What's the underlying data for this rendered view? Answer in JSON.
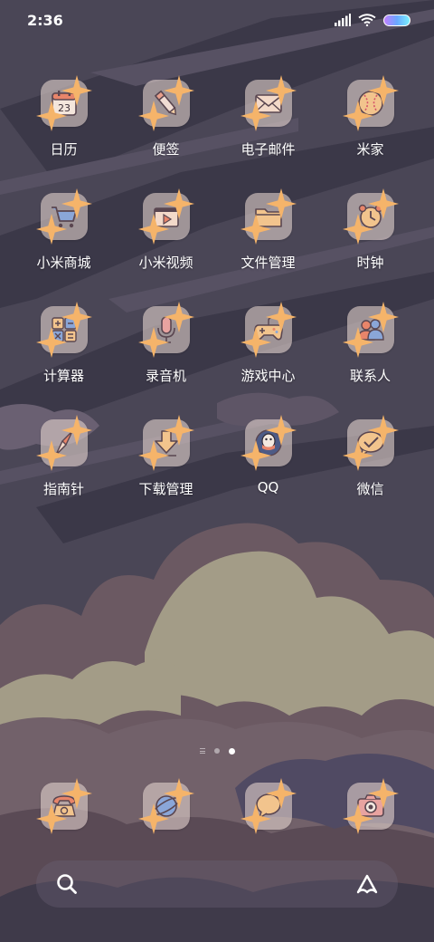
{
  "status_bar": {
    "time": "2:36"
  },
  "home_apps": [
    {
      "label": "日历",
      "icon": "calendar-icon",
      "date": "23"
    },
    {
      "label": "便签",
      "icon": "notes-icon"
    },
    {
      "label": "电子邮件",
      "icon": "mail-icon"
    },
    {
      "label": "米家",
      "icon": "mijia-icon"
    },
    {
      "label": "小米商城",
      "icon": "cart-icon"
    },
    {
      "label": "小米视频",
      "icon": "video-icon"
    },
    {
      "label": "文件管理",
      "icon": "folder-icon"
    },
    {
      "label": "时钟",
      "icon": "alarm-clock-icon"
    },
    {
      "label": "计算器",
      "icon": "calculator-icon"
    },
    {
      "label": "录音机",
      "icon": "microphone-icon"
    },
    {
      "label": "游戏中心",
      "icon": "gamepad-icon"
    },
    {
      "label": "联系人",
      "icon": "contacts-icon"
    },
    {
      "label": "指南针",
      "icon": "compass-icon"
    },
    {
      "label": "下载管理",
      "icon": "download-icon"
    },
    {
      "label": "QQ",
      "icon": "qq-icon"
    },
    {
      "label": "微信",
      "icon": "wechat-icon"
    }
  ],
  "dock_apps": [
    {
      "icon": "phone-icon"
    },
    {
      "icon": "browser-icon"
    },
    {
      "icon": "messages-icon"
    },
    {
      "icon": "camera-icon"
    }
  ],
  "search_bar": {
    "left_icon": "search-icon",
    "right_icon": "assistant-icon"
  },
  "colors": {
    "sky": "#4a4555",
    "cloud_light": "#a09a86",
    "cloud_dark": "#6b5a63",
    "icon_tile": "#e2d2cd",
    "icon_accent": "#e8ab5e",
    "spark": "#f5b46a"
  }
}
